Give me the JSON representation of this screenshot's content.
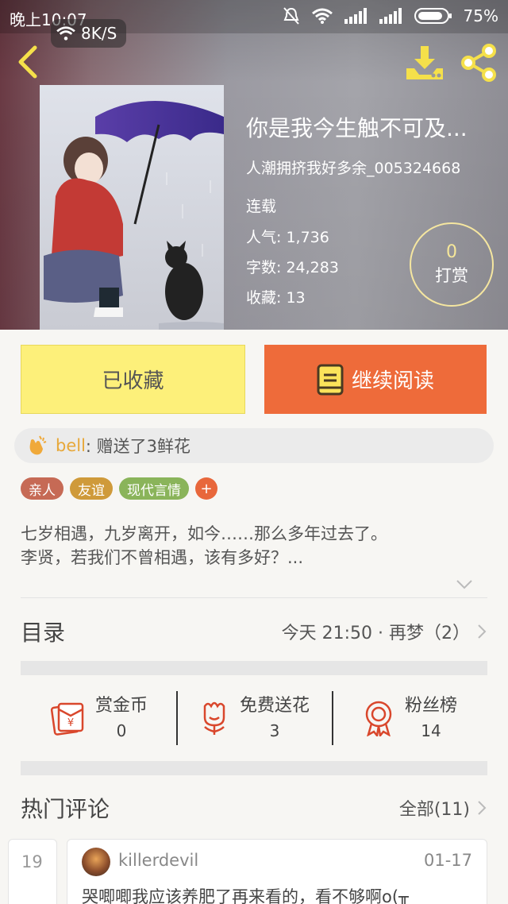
{
  "status_bar": {
    "time": "晚上10:07",
    "net_speed": "8K/S",
    "battery": "75%"
  },
  "book": {
    "title": "你是我今生触不可及...",
    "author": "人潮拥挤我好多余_005324668",
    "status": "连载",
    "popularity": "人气: 1,736",
    "word_count": "字数: 24,283",
    "favorites": "收藏: 13"
  },
  "tip": {
    "count": "0",
    "label": "打赏"
  },
  "actions": {
    "favorite_label": "已收藏",
    "read_label": "继续阅读"
  },
  "gift": {
    "user": "bell",
    "text": " : 赠送了3鲜花"
  },
  "tags": [
    {
      "label": "亲人",
      "color": "#c66a55"
    },
    {
      "label": "友谊",
      "color": "#cf9a3a"
    },
    {
      "label": "现代言情",
      "color": "#8ab45a"
    }
  ],
  "tag_add_label": "+",
  "synopsis": {
    "line1": "七岁相遇，九岁离开，如今……那么多年过去了。",
    "line2": "李贤，若我们不曾相遇，该有多好？..."
  },
  "toc": {
    "title": "目录",
    "latest": "今天 21:50 · 再梦（2）"
  },
  "stats": [
    {
      "label": "赏金币",
      "value": "0",
      "icon": "red-envelope-icon"
    },
    {
      "label": "免费送花",
      "value": "3",
      "icon": "flower-icon"
    },
    {
      "label": "粉丝榜",
      "value": "14",
      "icon": "medal-icon"
    }
  ],
  "hot_comments": {
    "title": "热门评论",
    "all_label": "全部(11)"
  },
  "comments": {
    "prev_date_fragment": "19",
    "user": "killerdevil",
    "date": "01-17",
    "text": "哭唧唧我应该养肥了再来看的，看不够啊o(╥"
  },
  "colors": {
    "accent_orange": "#ee6b3a",
    "favorite_yellow": "#fdf07a",
    "icon_yellow": "#f5e04a",
    "stat_red": "#d9472c"
  }
}
